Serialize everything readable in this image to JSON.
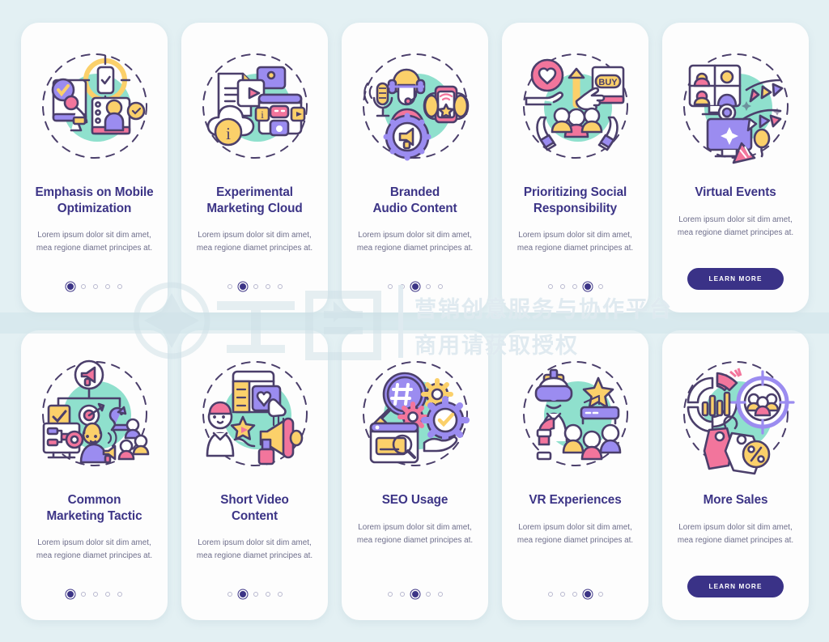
{
  "palette": {
    "background": "#e3f0f3",
    "card": "#fdfdfd",
    "title": "#3c3486",
    "body": "#6f6f8c",
    "accent_purple": "#9b8cf0",
    "accent_pink": "#f2759c",
    "accent_yellow": "#fbd06a",
    "accent_mint": "#8fe0cd",
    "outline": "#4b3f6b",
    "button": "#3a3287",
    "dot_inactive": "#b9b9cf"
  },
  "watermark": {
    "brand": "千图",
    "line1": "营销创意服务与协作平台",
    "line2": "商用请获取授权"
  },
  "cards": [
    {
      "id": "emphasis-on-mobile-optimization",
      "title": "Emphasis on Mobile\nOptimization",
      "body": "Lorem ipsum dolor sit dim amet, mea regione diamet principes at.",
      "footer_type": "dots",
      "dots_total": 5,
      "dot_active": 1,
      "illustration": "mobile-optimization-illustration"
    },
    {
      "id": "experimental-marketing-cloud",
      "title": "Experimental\nMarketing Cloud",
      "body": "Lorem ipsum dolor sit dim amet, mea regione diamet principes at.",
      "footer_type": "dots",
      "dots_total": 5,
      "dot_active": 2,
      "illustration": "marketing-cloud-illustration"
    },
    {
      "id": "branded-audio-content",
      "title": "Branded\nAudio Content",
      "body": "Lorem ipsum dolor sit dim amet, mea regione diamet principes at.",
      "footer_type": "dots",
      "dots_total": 5,
      "dot_active": 3,
      "illustration": "branded-audio-illustration"
    },
    {
      "id": "prioritizing-social-responsibility",
      "title": "Prioritizing Social\nResponsibility",
      "body": "Lorem ipsum dolor sit dim amet, mea regione diamet principes at.",
      "footer_type": "dots",
      "dots_total": 5,
      "dot_active": 4,
      "illustration": "social-responsibility-illustration"
    },
    {
      "id": "virtual-events",
      "title": "Virtual Events",
      "body": "Lorem ipsum dolor sit dim amet, mea regione diamet principes at.",
      "footer_type": "button",
      "button_label": "LEARN MORE",
      "illustration": "virtual-events-illustration"
    },
    {
      "id": "common-marketing-tactic",
      "title": "Common\nMarketing Tactic",
      "body": "Lorem ipsum dolor sit dim amet, mea regione diamet principes at.",
      "footer_type": "dots",
      "dots_total": 5,
      "dot_active": 1,
      "illustration": "marketing-tactic-illustration"
    },
    {
      "id": "short-video-content",
      "title": "Short Video\nContent",
      "body": "Lorem ipsum dolor sit dim amet, mea regione diamet principes at.",
      "footer_type": "dots",
      "dots_total": 5,
      "dot_active": 2,
      "illustration": "short-video-illustration"
    },
    {
      "id": "seo-usage",
      "title": "SEO Usage",
      "body": "Lorem ipsum dolor sit dim amet, mea regione diamet principes at.",
      "footer_type": "dots",
      "dots_total": 5,
      "dot_active": 3,
      "illustration": "seo-usage-illustration"
    },
    {
      "id": "vr-experiences",
      "title": "VR Experiences",
      "body": "Lorem ipsum dolor sit dim amet, mea regione diamet principes at.",
      "footer_type": "dots",
      "dots_total": 5,
      "dot_active": 4,
      "illustration": "vr-experiences-illustration"
    },
    {
      "id": "more-sales",
      "title": "More Sales",
      "body": "Lorem ipsum dolor sit dim amet, mea regione diamet principes at.",
      "footer_type": "button",
      "button_label": "LEARN MORE",
      "illustration": "more-sales-illustration"
    }
  ]
}
